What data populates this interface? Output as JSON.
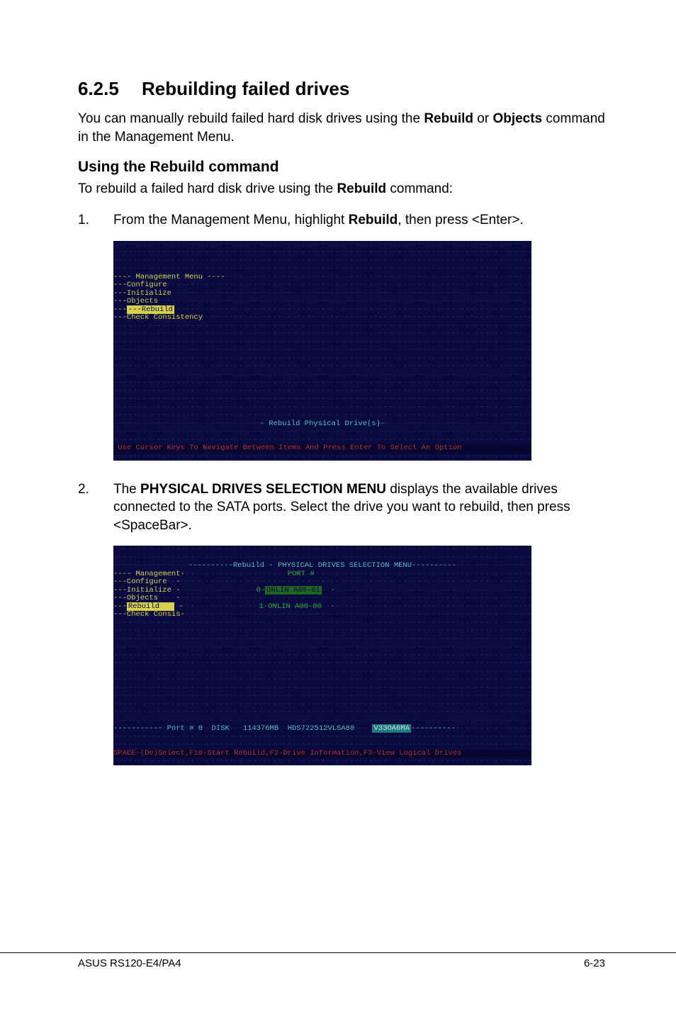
{
  "section": {
    "num": "6.2.5",
    "title": "Rebuilding failed drives"
  },
  "intro": {
    "pre": "You can manually rebuild failed hard disk drives using the ",
    "b1": "Rebuild",
    "mid": " or ",
    "b2": "Objects",
    "post": " command in the Management Menu."
  },
  "sub1": "Using the Rebuild command",
  "sub1_line": {
    "pre": "To rebuild a failed hard disk drive using the ",
    "b": "Rebuild",
    "post": " command:"
  },
  "step1": {
    "num": "1.",
    "pre": "From the Management Menu, highlight ",
    "b": "Rebuild",
    "post": ", then press <Enter>."
  },
  "term1": {
    "menu_header": "---- Management Menu ----",
    "items": {
      "configure": "---Configure",
      "initialize": "---Initialize",
      "objects": "---Objects",
      "rebuild": "---Rebuild",
      "check": "---Check Consistency"
    },
    "tip": "- Rebuild Physical Drive(s)-",
    "status": " Use Cursor Keys To Navigate Between Items And Press Enter To Select An Option "
  },
  "step2": {
    "num": "2.",
    "pre": "The ",
    "b": "PHYSICAL DRIVES SELECTION MENU",
    "post": " displays the available drives connected to the SATA ports. Select the drive you want to rebuild, then press <SpaceBar>."
  },
  "term2": {
    "title": "----------Rebuild - PHYSICAL DRIVES SELECTION MENU----------",
    "port_header": "PORT #",
    "menu_header": "---- Management-",
    "items": {
      "configure": "---Configure  -",
      "initialize": "---Initialize -",
      "objects": "---Objects    -",
      "rebuild": "---Rebuild    -",
      "check": "---Check Consis-"
    },
    "drive0": "0-ONLIN A00-01  -",
    "drive1": "1-ONLIN A00-00  -",
    "detail_pre": "----------- Port # 0  DISK   114376MB  HDS722512VLSA80    ",
    "detail_badge": "V33OA6MA",
    "detail_post": "----------",
    "status": "SPACE-(De)Select,F10-Start Rebuild,F2-Drive Information,F3-View Logical Drives"
  },
  "footer": {
    "left": "ASUS RS120-E4/PA4",
    "right": "6-23"
  }
}
